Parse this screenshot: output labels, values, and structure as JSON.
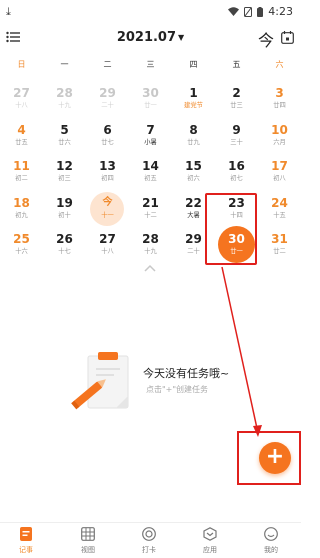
{
  "status_bar": {
    "left_icon": "download-icon",
    "time": "4:23"
  },
  "header": {
    "month": "2021.07",
    "today_label": "今"
  },
  "weekdays": [
    "日",
    "一",
    "二",
    "三",
    "四",
    "五",
    "六"
  ],
  "calendar": {
    "rows": [
      [
        {
          "num": "27",
          "sub": "十八",
          "other": true
        },
        {
          "num": "28",
          "sub": "十九",
          "other": true
        },
        {
          "num": "29",
          "sub": "二十",
          "other": true
        },
        {
          "num": "30",
          "sub": "廿一",
          "other": true
        },
        {
          "num": "1",
          "sub": "建党节",
          "type": "holiday"
        },
        {
          "num": "2",
          "sub": "廿三"
        },
        {
          "num": "3",
          "sub": "廿四"
        }
      ],
      [
        {
          "num": "4",
          "sub": "廿五"
        },
        {
          "num": "5",
          "sub": "廿六"
        },
        {
          "num": "6",
          "sub": "廿七"
        },
        {
          "num": "7",
          "sub": "小暑",
          "type": "term"
        },
        {
          "num": "8",
          "sub": "廿九"
        },
        {
          "num": "9",
          "sub": "三十"
        },
        {
          "num": "10",
          "sub": "六月"
        }
      ],
      [
        {
          "num": "11",
          "sub": "初二"
        },
        {
          "num": "12",
          "sub": "初三"
        },
        {
          "num": "13",
          "sub": "初四"
        },
        {
          "num": "14",
          "sub": "初五"
        },
        {
          "num": "15",
          "sub": "初六"
        },
        {
          "num": "16",
          "sub": "初七"
        },
        {
          "num": "17",
          "sub": "初八"
        }
      ],
      [
        {
          "num": "18",
          "sub": "初九"
        },
        {
          "num": "19",
          "sub": "初十"
        },
        {
          "num": "今",
          "sub": "十一",
          "today": true
        },
        {
          "num": "21",
          "sub": "十二"
        },
        {
          "num": "22",
          "sub": "大暑",
          "type": "term"
        },
        {
          "num": "23",
          "sub": "十四"
        },
        {
          "num": "24",
          "sub": "十五"
        }
      ],
      [
        {
          "num": "25",
          "sub": "十六"
        },
        {
          "num": "26",
          "sub": "十七"
        },
        {
          "num": "27",
          "sub": "十八"
        },
        {
          "num": "28",
          "sub": "十九"
        },
        {
          "num": "29",
          "sub": "二十"
        },
        {
          "num": "30",
          "sub": "廿一",
          "selected": true
        },
        {
          "num": "31",
          "sub": "廿二"
        }
      ]
    ]
  },
  "empty_state": {
    "title": "今天没有任务哦~",
    "hint": "点击\"+\"创建任务"
  },
  "fab": {
    "label": "+"
  },
  "bottom_nav": [
    {
      "label": "记事",
      "icon": "notes-icon",
      "active": true
    },
    {
      "label": "视图",
      "icon": "grid-view-icon"
    },
    {
      "label": "打卡",
      "icon": "checkin-icon"
    },
    {
      "label": "应用",
      "icon": "apps-icon"
    },
    {
      "label": "我的",
      "icon": "profile-icon"
    }
  ],
  "colors": {
    "accent": "#f5741f",
    "weekend": "#f08a2c",
    "annotation": "#e0201c"
  }
}
